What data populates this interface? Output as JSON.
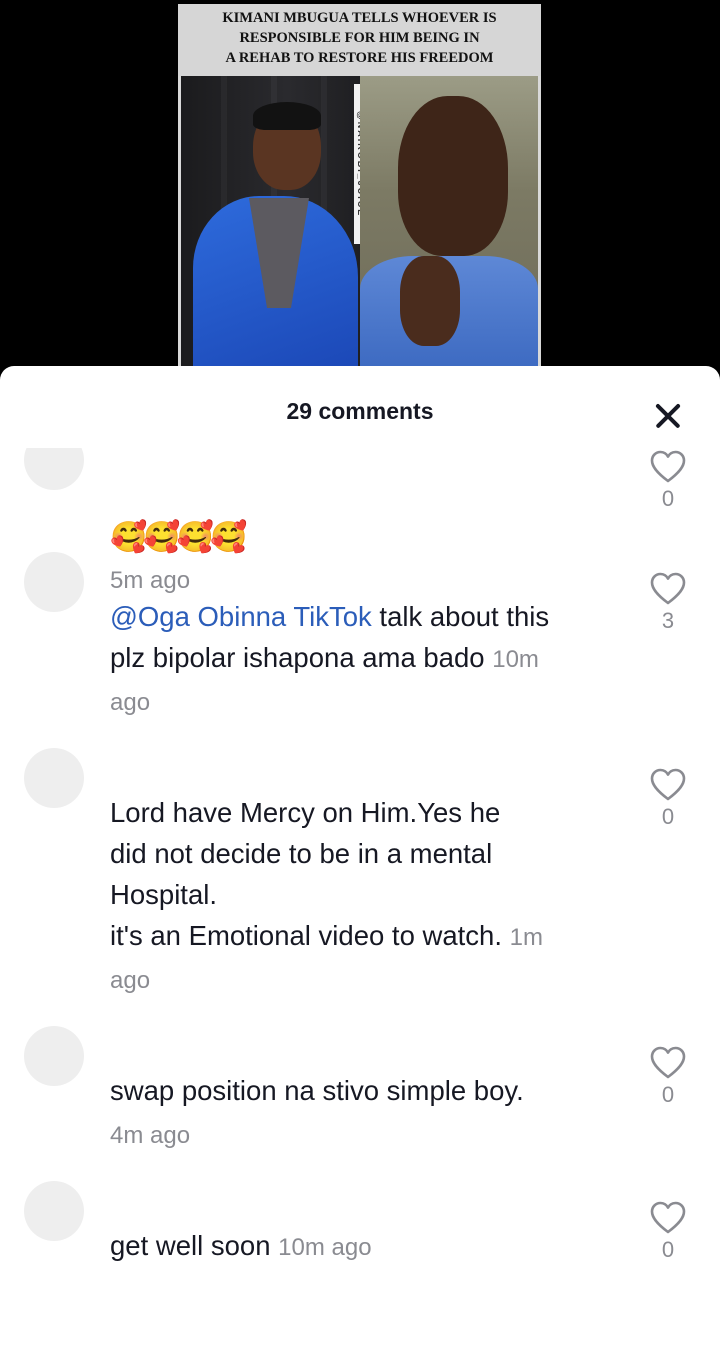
{
  "video": {
    "headline_lines": [
      "KIMANI MBUGUA TELLS WHOEVER IS",
      "RESPONSIBLE FOR HIM BEING IN",
      "A REHAB TO RESTORE HIS FREEDOM"
    ],
    "watermark": "@NAIROBI_JUICE"
  },
  "sheet": {
    "title": "29 comments",
    "close_icon": "close-icon"
  },
  "comments": [
    {
      "mention": "",
      "text": "🥰🥰🥰🥰",
      "time": "5m ago",
      "likes": "0"
    },
    {
      "mention": "@Oga Obinna TikTok",
      "text": " talk about this\nplz bipolar ishapona ama bado",
      "time": "10m\nago",
      "likes": "3"
    },
    {
      "mention": "",
      "text": "Lord have Mercy on Him.Yes he\ndid not decide to be in a mental\nHospital.\nit's an Emotional video to watch.",
      "time": "1m\nago",
      "likes": "0"
    },
    {
      "mention": "",
      "text": "swap position na stivo simple boy.",
      "time": "\n4m ago",
      "likes": "0"
    },
    {
      "mention": "",
      "text": "get well soon",
      "time": "10m ago",
      "likes": "0"
    }
  ],
  "colors": {
    "mention": "#2b5db9",
    "timestamp": "#8a8b91",
    "text": "#161823"
  }
}
